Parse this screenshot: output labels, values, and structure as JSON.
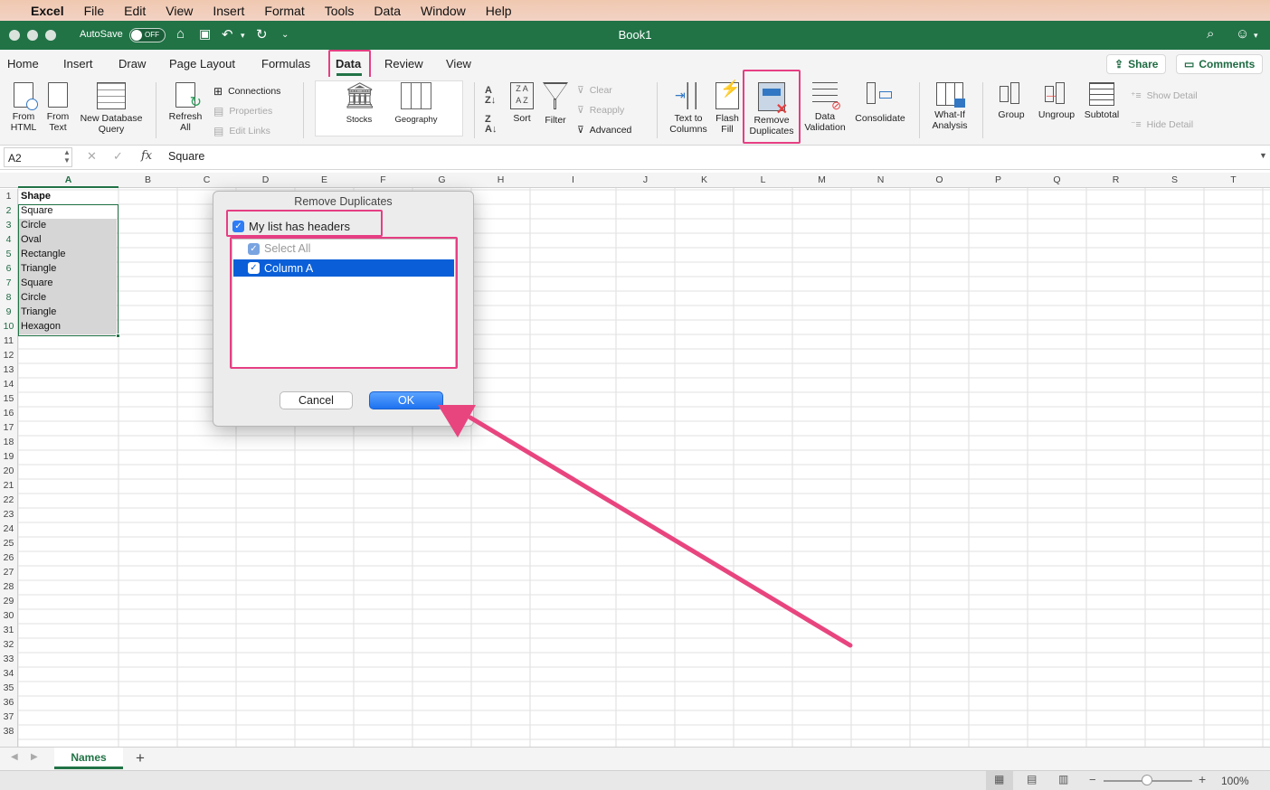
{
  "menubar": {
    "app": "Excel",
    "items": [
      "File",
      "Edit",
      "View",
      "Insert",
      "Format",
      "Tools",
      "Data",
      "Window",
      "Help"
    ]
  },
  "titlebar": {
    "autosave_label": "AutoSave",
    "autosave_state": "OFF",
    "title": "Book1"
  },
  "tabs": [
    "Home",
    "Insert",
    "Draw",
    "Page Layout",
    "Formulas",
    "Data",
    "Review",
    "View"
  ],
  "share_label": "Share",
  "comments_label": "Comments",
  "ribbon": {
    "from_html": [
      "From",
      "HTML"
    ],
    "from_text": [
      "From",
      "Text"
    ],
    "new_db_query": [
      "New Database",
      "Query"
    ],
    "refresh_all": [
      "Refresh",
      "All"
    ],
    "connections": "Connections",
    "properties": "Properties",
    "edit_links": "Edit Links",
    "stocks": "Stocks",
    "geography": "Geography",
    "sort": "Sort",
    "filter": "Filter",
    "clear": "Clear",
    "reapply": "Reapply",
    "advanced": "Advanced",
    "text_to_columns": [
      "Text to",
      "Columns"
    ],
    "flash_fill": [
      "Flash",
      "Fill"
    ],
    "remove_duplicates": [
      "Remove",
      "Duplicates"
    ],
    "data_validation": [
      "Data",
      "Validation"
    ],
    "consolidate": "Consolidate",
    "what_if": [
      "What-If",
      "Analysis"
    ],
    "group": "Group",
    "ungroup": "Ungroup",
    "subtotal": "Subtotal",
    "show_detail": "Show Detail",
    "hide_detail": "Hide Detail"
  },
  "formula_bar": {
    "name_box": "A2",
    "fx": "fx",
    "value": "Square"
  },
  "columns": [
    "A",
    "B",
    "C",
    "D",
    "E",
    "F",
    "G",
    "H",
    "I",
    "J",
    "K",
    "L",
    "M",
    "N",
    "O",
    "P",
    "Q",
    "R",
    "S",
    "T"
  ],
  "rows": [
    "1",
    "2",
    "3",
    "4",
    "5",
    "6",
    "7",
    "8",
    "9",
    "10",
    "11",
    "12",
    "13",
    "14",
    "15",
    "16",
    "17",
    "18",
    "19",
    "20",
    "21",
    "22",
    "23",
    "24",
    "25",
    "26",
    "27",
    "28",
    "29",
    "30",
    "31",
    "32",
    "33",
    "34",
    "35",
    "36",
    "37",
    "38"
  ],
  "cells_a": [
    "Shape",
    "Square",
    "Circle",
    "Oval",
    "Rectangle",
    "Triangle",
    "Square",
    "Circle",
    "Triangle",
    "Hexagon"
  ],
  "dialog": {
    "title": "Remove Duplicates",
    "headers_label": "My list has headers",
    "select_all": "Select All",
    "column_a": "Column A",
    "cancel": "Cancel",
    "ok": "OK"
  },
  "sheet_tab": "Names",
  "add_sheet": "+",
  "zoom": "100%",
  "colors": {
    "excel_green": "#217346",
    "highlight": "#e63e83",
    "selection_blue": "#0a5fd8"
  }
}
